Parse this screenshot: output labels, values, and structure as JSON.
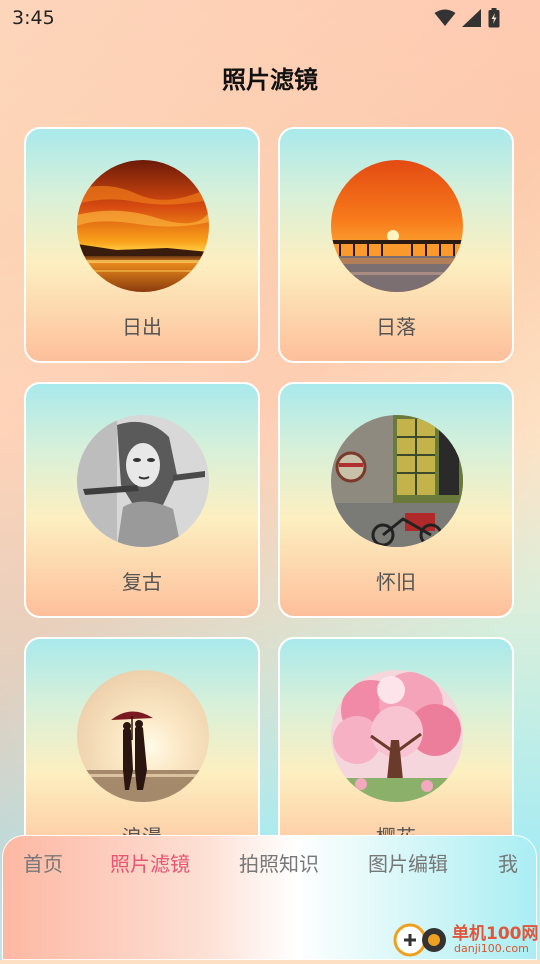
{
  "status": {
    "time": "3:45",
    "icons": [
      "wifi-icon",
      "signal-icon",
      "battery-icon"
    ]
  },
  "page": {
    "title": "照片滤镜"
  },
  "filters": [
    {
      "label": "日出",
      "image": "sunrise-photo"
    },
    {
      "label": "日落",
      "image": "sunset-pier-photo"
    },
    {
      "label": "复古",
      "image": "vintage-bw-portrait-photo"
    },
    {
      "label": "怀旧",
      "image": "nostalgic-street-photo"
    },
    {
      "label": "浪漫",
      "image": "romantic-couple-umbrella-photo"
    },
    {
      "label": "樱花",
      "image": "cherry-blossom-tree-photo"
    }
  ],
  "nav": {
    "items": [
      "首页",
      "照片滤镜",
      "拍照知识",
      "图片编辑",
      "我"
    ],
    "active_index": 1
  },
  "watermark": {
    "title": "单机100网",
    "url": "danji100.com"
  },
  "colors": {
    "active": "#e85474",
    "inactive": "#777777",
    "watermark": "#e0563a"
  }
}
